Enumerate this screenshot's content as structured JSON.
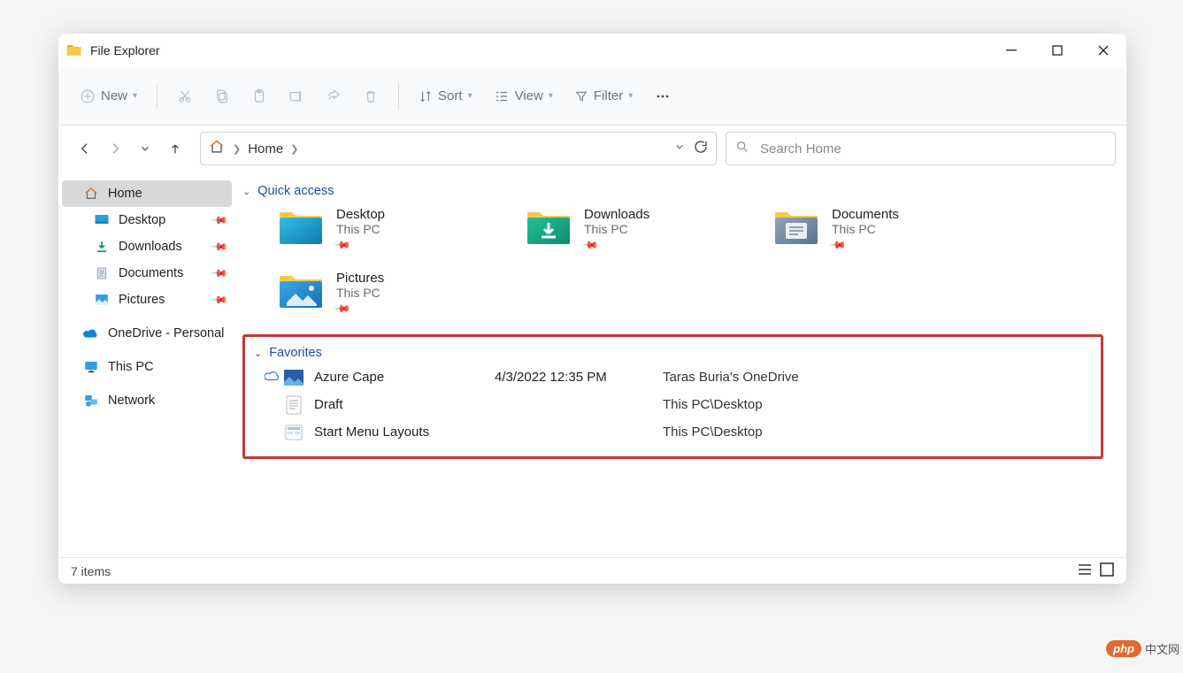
{
  "window": {
    "title": "File Explorer"
  },
  "win_controls": {
    "min": "minimize",
    "max": "maximize",
    "close": "close"
  },
  "toolbar": {
    "new_label": "New",
    "sort_label": "Sort",
    "view_label": "View",
    "filter_label": "Filter"
  },
  "nav": {
    "back": "back",
    "forward": "forward",
    "recent": "recent",
    "up": "up",
    "refresh": "refresh",
    "dropdown": "dropdown"
  },
  "address": {
    "home": "Home"
  },
  "search": {
    "placeholder": "Search Home"
  },
  "sidebar": {
    "home": "Home",
    "desktop": "Desktop",
    "downloads": "Downloads",
    "documents": "Documents",
    "pictures": "Pictures",
    "onedrive": "OneDrive - Personal",
    "thispc": "This PC",
    "network": "Network"
  },
  "sections": {
    "quick_access": "Quick access",
    "favorites": "Favorites"
  },
  "quick_access": [
    {
      "name": "Desktop",
      "sub": "This PC",
      "color1": "#2aa6d6",
      "color2": "#0a6aa1",
      "icon": "desktop"
    },
    {
      "name": "Downloads",
      "sub": "This PC",
      "color1": "#1fb695",
      "color2": "#0c8a6d",
      "icon": "downloads"
    },
    {
      "name": "Documents",
      "sub": "This PC",
      "color1": "#7d94ae",
      "color2": "#5a708a",
      "icon": "documents"
    },
    {
      "name": "Pictures",
      "sub": "This PC",
      "color1": "#3aa7e8",
      "color2": "#1770b5",
      "icon": "pictures"
    }
  ],
  "favorites": [
    {
      "name": "Azure Cape",
      "date": "4/3/2022 12:35 PM",
      "location": "Taras Buria's OneDrive",
      "cloud": true,
      "icon": "image"
    },
    {
      "name": "Draft",
      "date": "",
      "location": "This PC\\Desktop",
      "cloud": false,
      "icon": "text"
    },
    {
      "name": "Start Menu Layouts",
      "date": "",
      "location": "This PC\\Desktop",
      "cloud": false,
      "icon": "layout"
    }
  ],
  "status": {
    "items": "7 items"
  },
  "watermark": {
    "brand": "php",
    "text": "中文网"
  }
}
